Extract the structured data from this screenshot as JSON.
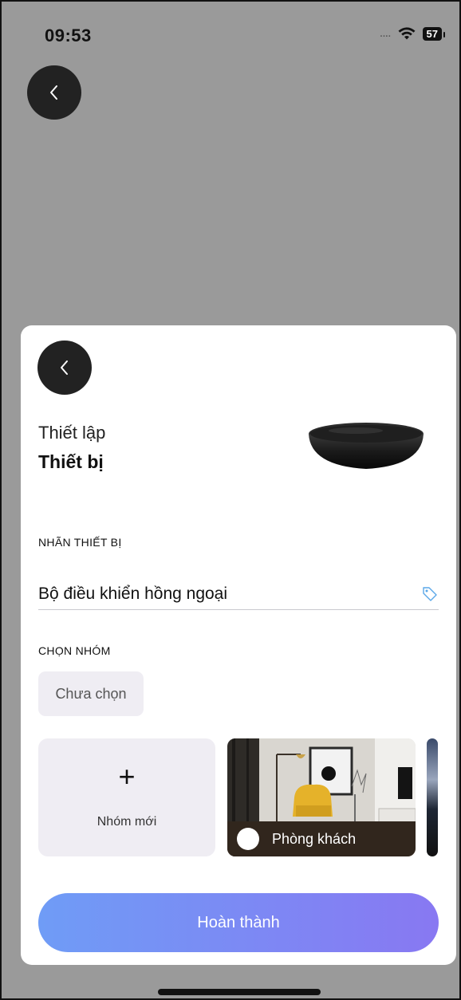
{
  "status_bar": {
    "time": "09:53",
    "signal": "....",
    "battery": "57"
  },
  "sheet": {
    "subtitle": "Thiết lập",
    "title": "Thiết bị",
    "device_label_heading": "NHÃN THIẾT BỊ",
    "device_label_value": "Bộ điều khiển hồng ngoại",
    "group_heading": "CHỌN NHÓM",
    "group_selected": "Chưa chọn",
    "new_group_label": "Nhóm mới",
    "room_card_label": "Phòng khách",
    "done_label": "Hoàn thành"
  },
  "colors": {
    "backdrop": "#9a9a9a",
    "button_gradient_start": "#6f9cf6",
    "button_gradient_end": "#8878f2",
    "chip_bg": "#efedf3"
  },
  "icons": [
    "chevron-left-icon",
    "wifi-icon",
    "battery-icon",
    "tag-icon",
    "plus-icon"
  ]
}
